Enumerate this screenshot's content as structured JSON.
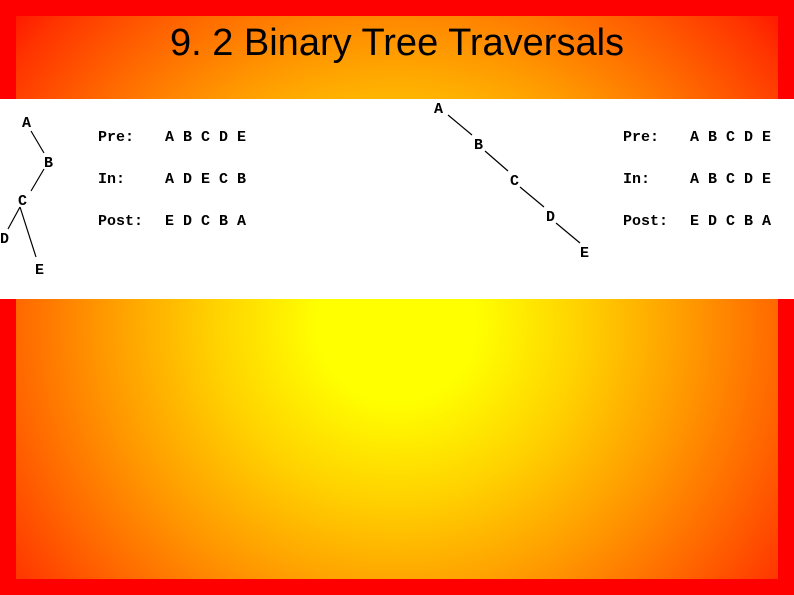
{
  "title": "9. 2 Binary Tree Traversals",
  "left": {
    "nodes": {
      "A": "A",
      "B": "B",
      "C": "C",
      "D": "D",
      "E": "E"
    },
    "trav": {
      "pre_label": "Pre:",
      "pre_value": "A B C D E",
      "in_label": "In:",
      "in_value": "A D E C B",
      "post_label": "Post:",
      "post_value": "E D C B A"
    }
  },
  "right": {
    "nodes": {
      "A": "A",
      "B": "B",
      "C": "C",
      "D": "D",
      "E": "E"
    },
    "trav": {
      "pre_label": "Pre:",
      "pre_value": "A B C D E",
      "in_label": "In:",
      "in_value": "A B C D E",
      "post_label": "Post:",
      "post_value": "E D C B A"
    }
  }
}
